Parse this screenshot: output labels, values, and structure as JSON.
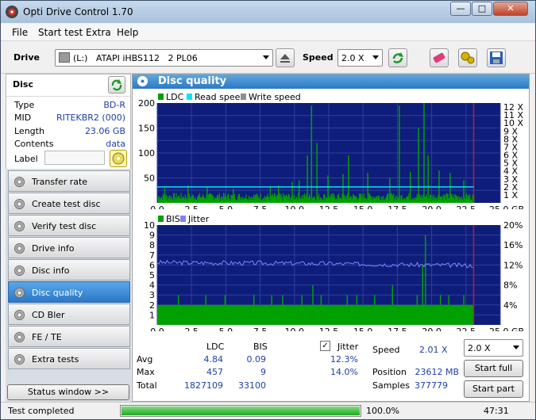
{
  "window": {
    "title": "Opti Drive Control 1.70",
    "min": "—",
    "max": "□",
    "close": "✕"
  },
  "menu": [
    "File",
    "Start test",
    "Extra",
    "Help"
  ],
  "toolbar": {
    "drive_label": "Drive",
    "drive_value": "(L:)   ATAPI iHBS112   2 PL06",
    "speed_label": "Speed",
    "speed_value": "2.0 X"
  },
  "disc": {
    "title": "Disc",
    "rows": [
      {
        "label": "Type",
        "value": "BD-R"
      },
      {
        "label": "MID",
        "value": "RITEKBR2 (000)"
      },
      {
        "label": "Length",
        "value": "23.06 GB"
      },
      {
        "label": "Contents",
        "value": "data"
      },
      {
        "label": "Label",
        "value": ""
      }
    ]
  },
  "nav": [
    {
      "label": "Transfer rate",
      "active": false
    },
    {
      "label": "Create test disc",
      "active": false
    },
    {
      "label": "Verify test disc",
      "active": false
    },
    {
      "label": "Drive info",
      "active": false
    },
    {
      "label": "Disc info",
      "active": false
    },
    {
      "label": "Disc quality",
      "active": true
    },
    {
      "label": "CD Bler",
      "active": false
    },
    {
      "label": "FE / TE",
      "active": false
    },
    {
      "label": "Extra tests",
      "active": false
    }
  ],
  "status_window_button": "Status window >>",
  "panel_title": "Disc quality",
  "chart_data": [
    {
      "type": "bar",
      "legend": [
        "LDC",
        "Read speed",
        "Write speed"
      ],
      "legend_colors": [
        "#00a000",
        "#00e5ff",
        "#909090"
      ],
      "x_ticks": [
        "0.0",
        "2.5",
        "5.0",
        "7.5",
        "10.0",
        "12.5",
        "15.0",
        "17.5",
        "20.0",
        "22.5",
        "25.0 GB"
      ],
      "y_ticks_left": [
        "200",
        "150",
        "100",
        "50"
      ],
      "y_ticks_right": [
        "12 X",
        "11 X",
        "10 X",
        "9 X",
        "8 X",
        "7 X",
        "6 X",
        "5 X",
        "4 X",
        "3 X",
        "2 X",
        "1 X"
      ],
      "xlim": [
        0,
        25
      ],
      "ylim": [
        0,
        200
      ],
      "x_end": 23.06,
      "baseline_band": [
        5,
        20
      ],
      "spikes": [
        [
          0.5,
          30
        ],
        [
          2.2,
          35
        ],
        [
          3.6,
          32
        ],
        [
          5.5,
          28
        ],
        [
          8.2,
          32
        ],
        [
          8.8,
          35
        ],
        [
          9.8,
          42
        ],
        [
          10.3,
          45
        ],
        [
          10.9,
          95
        ],
        [
          11.2,
          195
        ],
        [
          11.6,
          120
        ],
        [
          12.4,
          55
        ],
        [
          13.5,
          58
        ],
        [
          13.9,
          95
        ],
        [
          15.3,
          60
        ],
        [
          16.9,
          50
        ],
        [
          17.6,
          195
        ],
        [
          18.4,
          62
        ],
        [
          19.0,
          150
        ],
        [
          19.4,
          200
        ],
        [
          19.7,
          95
        ],
        [
          20.5,
          65
        ],
        [
          21.3,
          60
        ],
        [
          22.3,
          45
        ]
      ],
      "read_speed_x": 2.0
    },
    {
      "type": "bar",
      "legend": [
        "BIS",
        "Jitter"
      ],
      "legend_colors": [
        "#00a000",
        "#8080ff"
      ],
      "x_ticks": [
        "0.0",
        "2.5",
        "5.0",
        "7.5",
        "10.0",
        "12.5",
        "15.0",
        "17.5",
        "20.0",
        "22.5",
        "25.0 GB"
      ],
      "y_ticks_left": [
        "10",
        "9",
        "8",
        "7",
        "6",
        "5",
        "4",
        "3",
        "2",
        "1"
      ],
      "y_ticks_right": [
        "20%",
        "16%",
        "12%",
        "8%",
        "4%"
      ],
      "xlim": [
        0,
        25
      ],
      "ylim": [
        0,
        10
      ],
      "baseline": 2,
      "spikes": [
        [
          1.5,
          3
        ],
        [
          3.5,
          3
        ],
        [
          4.9,
          3
        ],
        [
          7.0,
          3
        ],
        [
          8.3,
          3
        ],
        [
          9.1,
          3
        ],
        [
          10.5,
          3
        ],
        [
          11.3,
          4
        ],
        [
          11.9,
          3
        ],
        [
          13.8,
          3
        ],
        [
          14.5,
          3
        ],
        [
          15.8,
          3
        ],
        [
          17.1,
          4
        ],
        [
          18.9,
          3
        ],
        [
          19.3,
          6
        ],
        [
          19.5,
          9
        ],
        [
          20.6,
          3
        ],
        [
          21.2,
          3
        ],
        [
          22.3,
          3
        ]
      ],
      "jitter_start": 12.5,
      "jitter_mid": 12.3,
      "jitter_end": 11.9
    }
  ],
  "stats": {
    "col_ldc": "LDC",
    "col_bis": "BIS",
    "jitter_label": "Jitter",
    "rows": [
      {
        "label": "Avg",
        "ldc": "4.84",
        "bis": "0.09",
        "jitter": "12.3%"
      },
      {
        "label": "Max",
        "ldc": "457",
        "bis": "9",
        "jitter": "14.0%"
      },
      {
        "label": "Total",
        "ldc": "1827109",
        "bis": "33100",
        "jitter": ""
      }
    ],
    "speed_label": "Speed",
    "speed_value": "2.01 X",
    "position_label": "Position",
    "position_value": "23612 MB",
    "samples_label": "Samples",
    "samples_value": "377779",
    "speed_select": "2.0 X",
    "start_full": "Start full",
    "start_part": "Start part"
  },
  "status": {
    "text": "Test completed",
    "progress": 100,
    "progress_text": "100.0%",
    "time": "47:31"
  }
}
